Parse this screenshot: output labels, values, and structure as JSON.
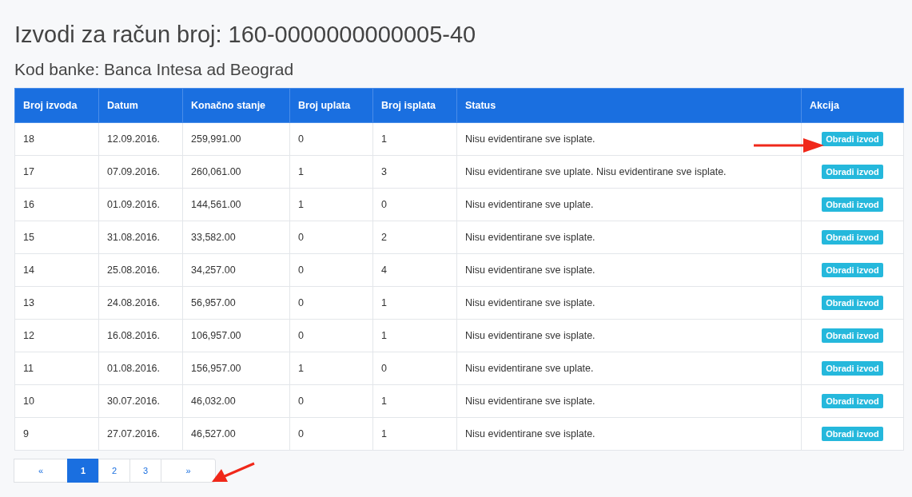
{
  "title": "Izvodi za račun broj: 160-0000000000005-40",
  "subtitle": "Kod banke: Banca Intesa ad Beograd",
  "table": {
    "columns": [
      "Broj izvoda",
      "Datum",
      "Konačno stanje",
      "Broj uplata",
      "Broj isplata",
      "Status",
      "Akcija"
    ],
    "rows": [
      {
        "cells": [
          "18",
          "12.09.2016.",
          "259,991.00",
          "0",
          "1",
          "Nisu evidentirane sve isplate."
        ],
        "action": "Obradi izvod"
      },
      {
        "cells": [
          "17",
          "07.09.2016.",
          "260,061.00",
          "1",
          "3",
          "Nisu evidentirane sve uplate. Nisu evidentirane sve isplate."
        ],
        "action": "Obradi izvod"
      },
      {
        "cells": [
          "16",
          "01.09.2016.",
          "144,561.00",
          "1",
          "0",
          "Nisu evidentirane sve uplate."
        ],
        "action": "Obradi izvod"
      },
      {
        "cells": [
          "15",
          "31.08.2016.",
          "33,582.00",
          "0",
          "2",
          "Nisu evidentirane sve isplate."
        ],
        "action": "Obradi izvod"
      },
      {
        "cells": [
          "14",
          "25.08.2016.",
          "34,257.00",
          "0",
          "4",
          "Nisu evidentirane sve isplate."
        ],
        "action": "Obradi izvod"
      },
      {
        "cells": [
          "13",
          "24.08.2016.",
          "56,957.00",
          "0",
          "1",
          "Nisu evidentirane sve isplate."
        ],
        "action": "Obradi izvod"
      },
      {
        "cells": [
          "12",
          "16.08.2016.",
          "106,957.00",
          "0",
          "1",
          "Nisu evidentirane sve isplate."
        ],
        "action": "Obradi izvod"
      },
      {
        "cells": [
          "11",
          "01.08.2016.",
          "156,957.00",
          "1",
          "0",
          "Nisu evidentirane sve uplate."
        ],
        "action": "Obradi izvod"
      },
      {
        "cells": [
          "10",
          "30.07.2016.",
          "46,032.00",
          "0",
          "1",
          "Nisu evidentirane sve isplate."
        ],
        "action": "Obradi izvod"
      },
      {
        "cells": [
          "9",
          "27.07.2016.",
          "46,527.00",
          "0",
          "1",
          "Nisu evidentirane sve isplate."
        ],
        "action": "Obradi izvod"
      }
    ]
  },
  "pagination": [
    {
      "label": "«",
      "selected": false
    },
    {
      "label": "1",
      "selected": true
    },
    {
      "label": "2",
      "selected": false
    },
    {
      "label": "3",
      "selected": false
    },
    {
      "label": "»",
      "selected": false
    }
  ]
}
